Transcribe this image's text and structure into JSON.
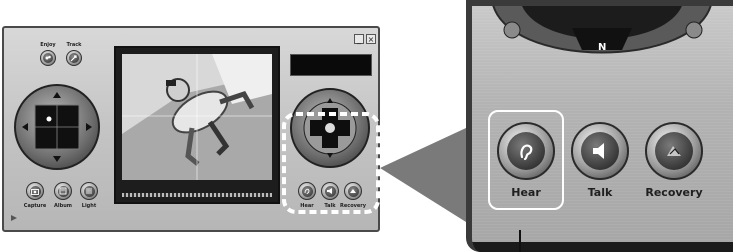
{
  "app": {
    "top_buttons": [
      {
        "label": "Enjoy",
        "icon": "joy-icon"
      },
      {
        "label": "Track",
        "icon": "track-icon"
      }
    ],
    "window_controls": {
      "minimize": "_",
      "close": "×"
    },
    "bottom_left_buttons": [
      {
        "label": "Capture",
        "icon": "camera-icon"
      },
      {
        "label": "Album",
        "icon": "album-icon"
      },
      {
        "label": "Light",
        "icon": "light-icon"
      }
    ],
    "bottom_right_buttons": [
      {
        "label": "Hear",
        "icon": "ear-icon"
      },
      {
        "label": "Talk",
        "icon": "speaker-icon"
      },
      {
        "label": "Recovery",
        "icon": "recovery-icon"
      }
    ]
  },
  "zoom": {
    "compass_letter": "N",
    "buttons": [
      {
        "label": "Hear",
        "icon": "ear-icon"
      },
      {
        "label": "Talk",
        "icon": "speaker-icon"
      },
      {
        "label": "Recovery",
        "icon": "recovery-icon"
      }
    ]
  },
  "colors": {
    "panel": "#c4c4c4",
    "highlight_border": "#ffffff",
    "callout": "#7a7a7a"
  }
}
